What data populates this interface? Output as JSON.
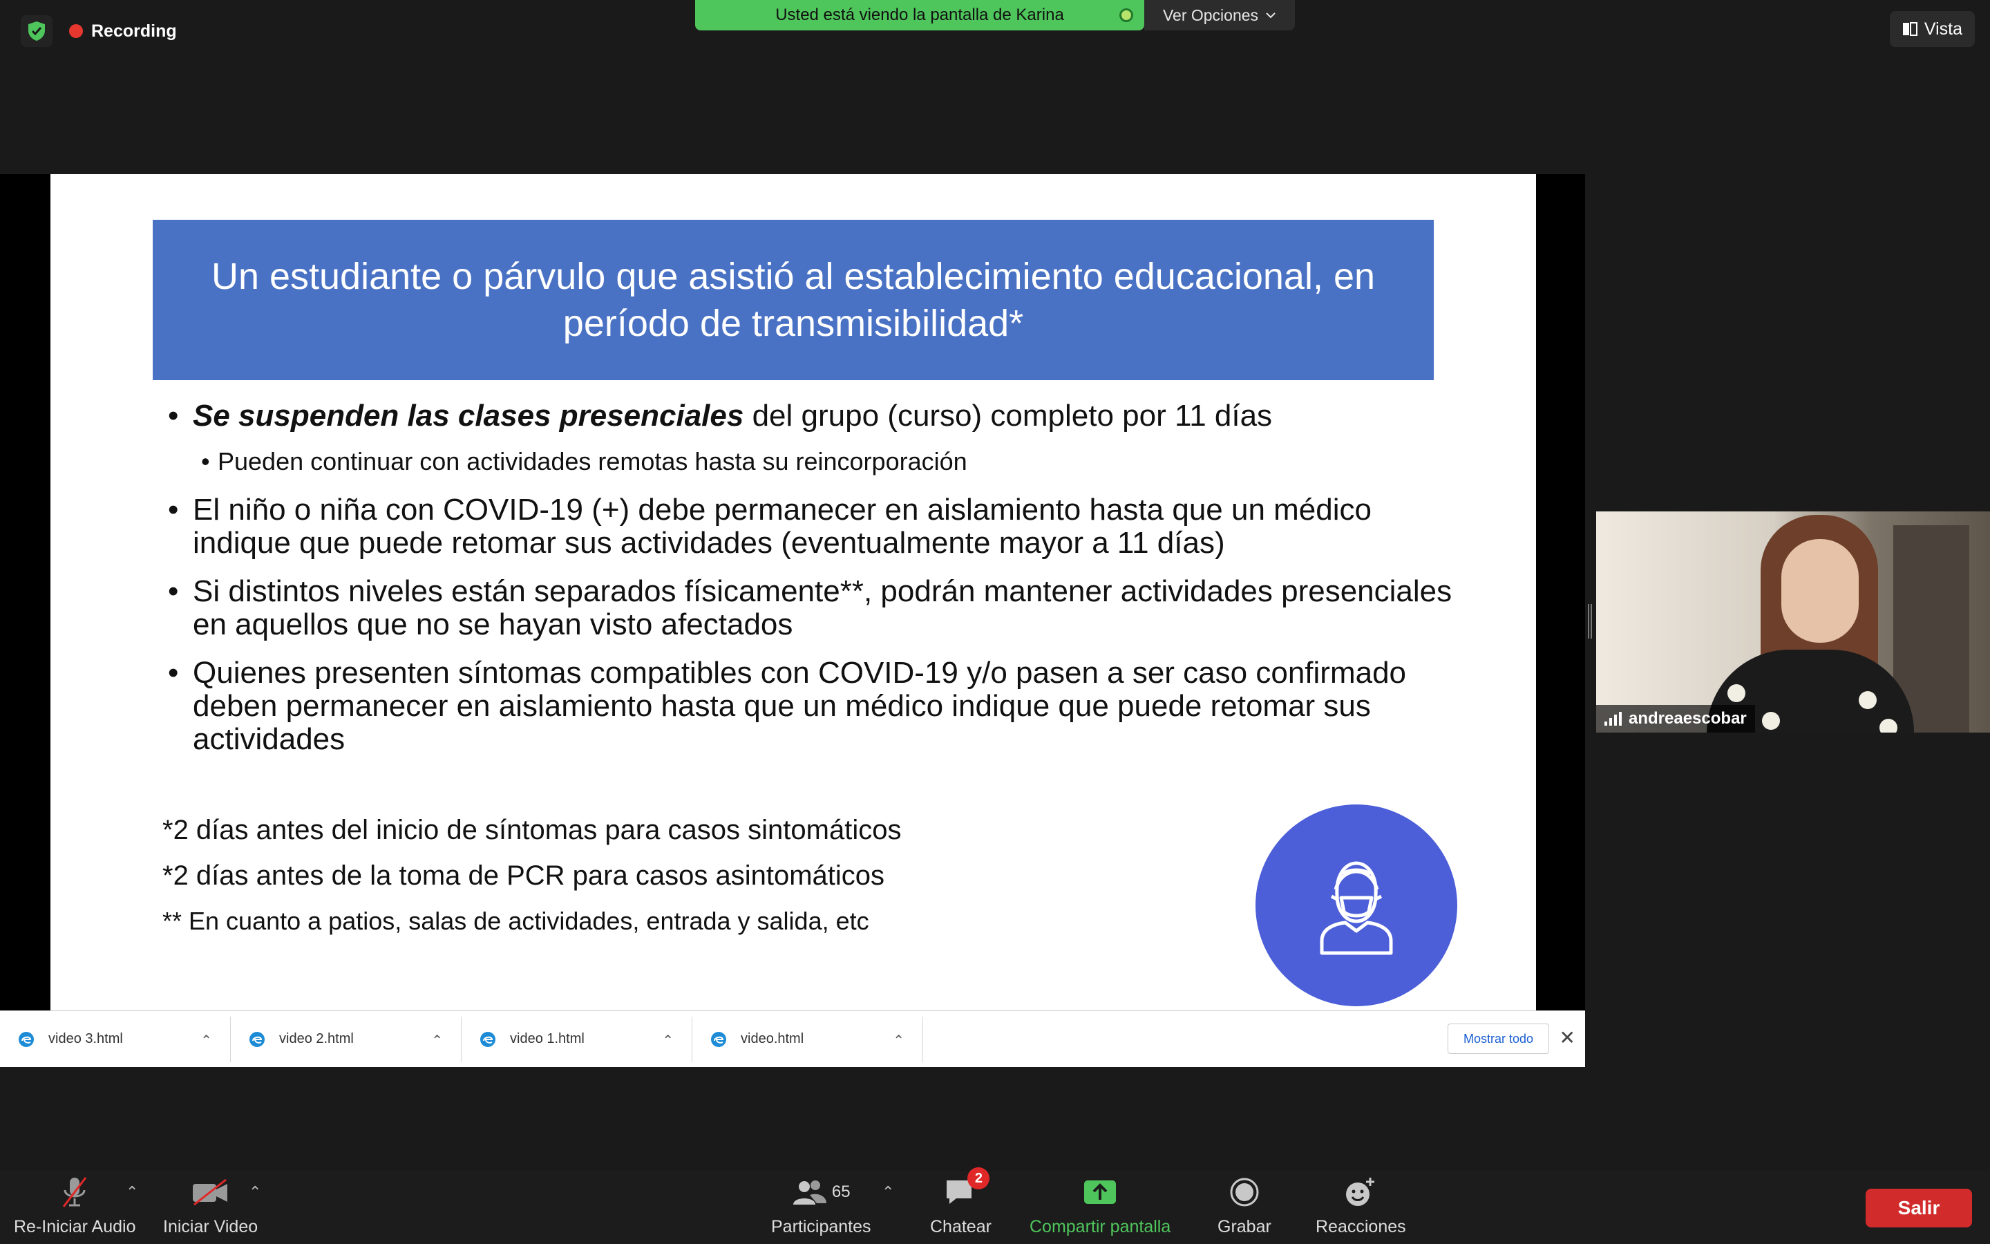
{
  "top_bar": {
    "recording_label": "Recording",
    "viewing_banner": "Usted está viendo la pantalla de Karina",
    "view_options_label": "Ver Opciones",
    "vista_label": "Vista"
  },
  "slide": {
    "title": "Un estudiante o párvulo que asistió al establecimiento educacional, en período de transmisibilidad*",
    "bullet1_emphasis": "Se suspenden las clases presenciales",
    "bullet1_rest": " del grupo (curso) completo por 11 días",
    "bullet1_sub": "Pueden continuar con actividades remotas hasta su reincorporación",
    "bullet2": "El niño o niña con COVID-19 (+) debe permanecer en aislamiento hasta que un médico indique que puede retomar sus actividades (eventualmente mayor a 11 días)",
    "bullet3": "Si distintos niveles están separados físicamente**, podrán mantener actividades presenciales en aquellos que no se hayan visto afectados",
    "bullet4": "Quienes presenten síntomas compatibles con COVID-19 y/o pasen a ser caso confirmado deben permanecer en aislamiento hasta que un médico indique que puede retomar sus actividades",
    "note1": "*2 días antes del inicio de síntomas para casos sintomáticos",
    "note2": "*2 días antes de la toma de PCR para casos asintomáticos",
    "note3": "** En cuanto a patios, salas de actividades, entrada y salida, etc",
    "icon": "masked-person-icon"
  },
  "downloads": {
    "items": [
      {
        "name": "video 3.html"
      },
      {
        "name": "video 2.html"
      },
      {
        "name": "video 1.html"
      },
      {
        "name": "video.html"
      }
    ],
    "show_all_label": "Mostrar todo"
  },
  "participant": {
    "name": "andreaescobar"
  },
  "toolbar": {
    "audio_label": "Re-Iniciar Audio",
    "video_label": "Iniciar Video",
    "participants_label": "Participantes",
    "participants_count": "65",
    "chat_label": "Chatear",
    "chat_badge": "2",
    "share_label": "Compartir pantalla",
    "record_label": "Grabar",
    "reactions_label": "Reacciones",
    "leave_label": "Salir"
  },
  "colors": {
    "banner_green": "#4fc65c",
    "slide_header_blue": "#4a72c4",
    "icon_circle_blue": "#4c5ed8",
    "leave_red": "#d12b2b"
  }
}
